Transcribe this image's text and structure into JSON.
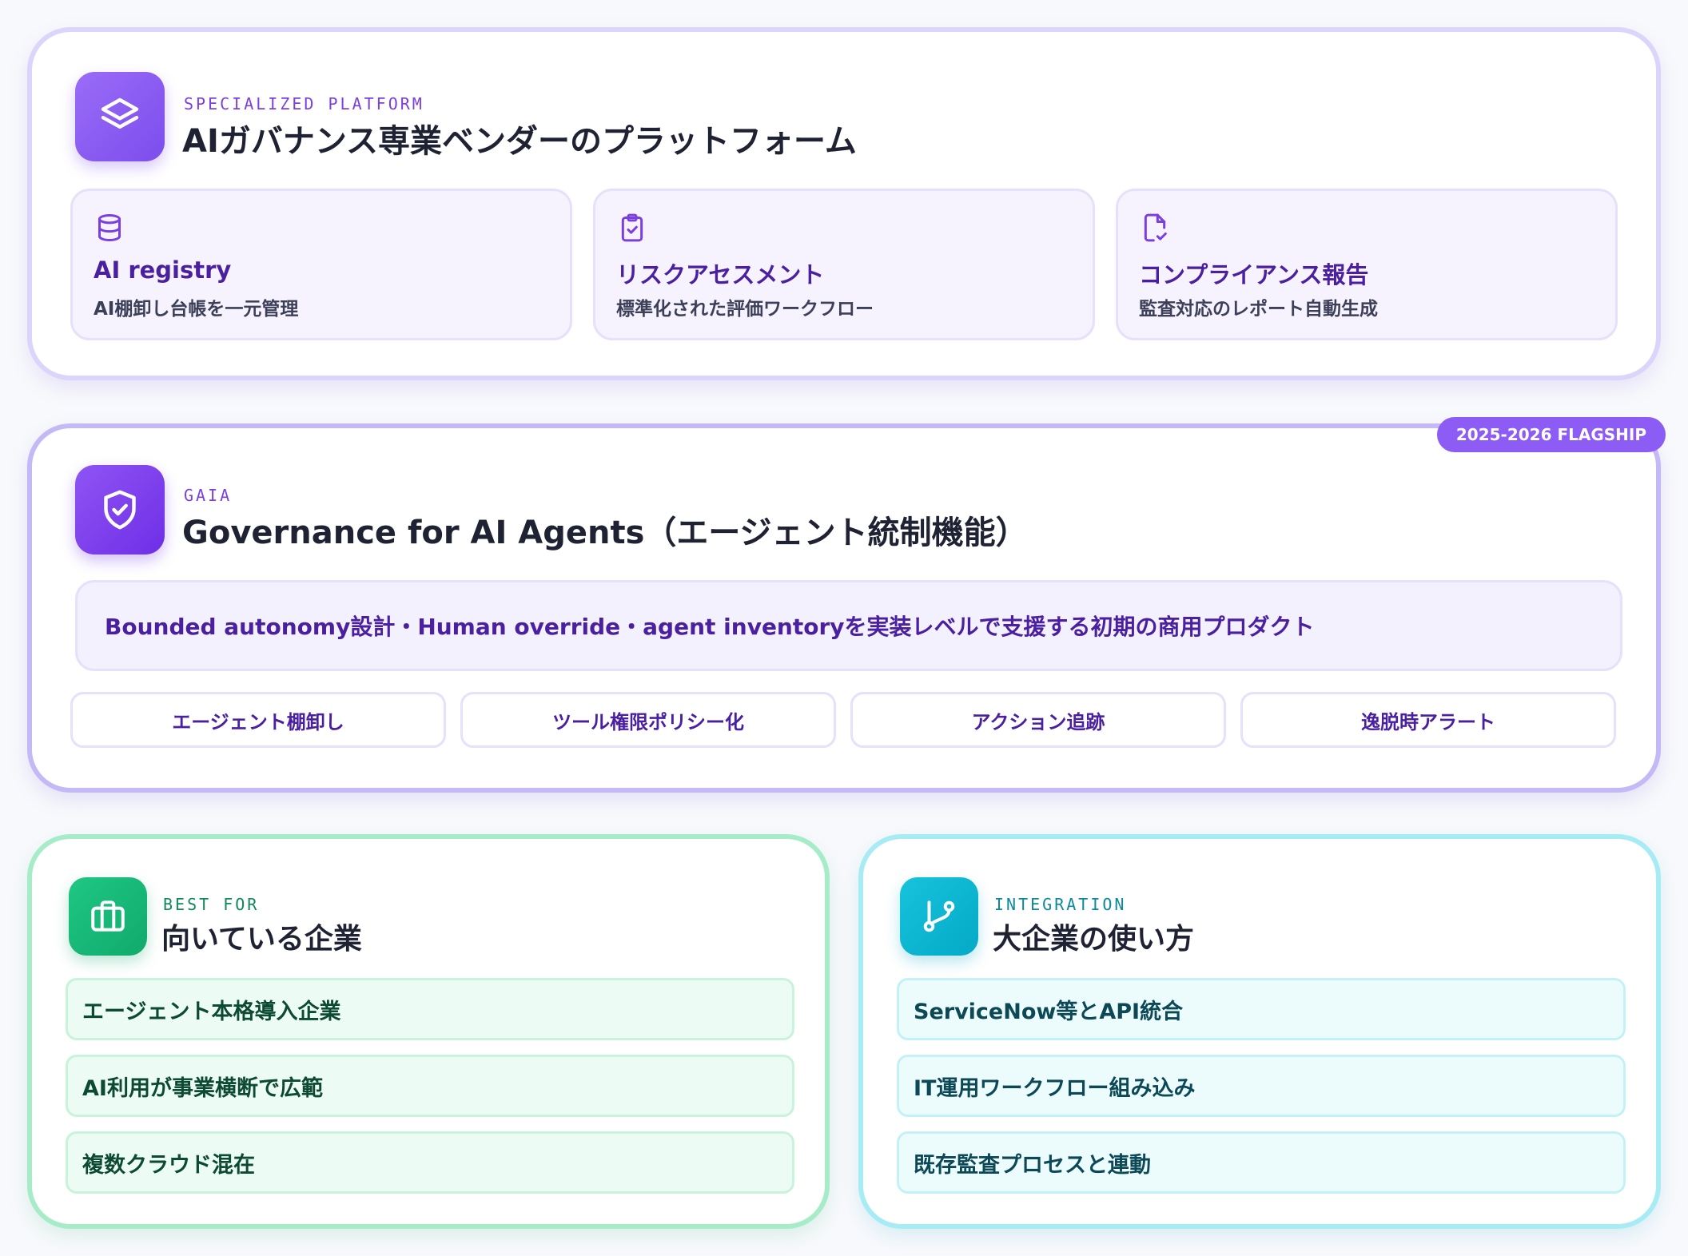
{
  "platform": {
    "eyebrow": "SPECIALIZED PLATFORM",
    "title": "AIガバナンス専業ベンダーのプラットフォーム",
    "icon": "layers-icon",
    "features": [
      {
        "icon": "database-icon",
        "title": "AI registry",
        "desc": "AI棚卸し台帳を一元管理"
      },
      {
        "icon": "clipboard-check-icon",
        "title": "リスクアセスメント",
        "desc": "標準化された評価ワークフロー"
      },
      {
        "icon": "file-check-icon",
        "title": "コンプライアンス報告",
        "desc": "監査対応のレポート自動生成"
      }
    ]
  },
  "gaia": {
    "badge": "2025-2026 FLAGSHIP",
    "eyebrow": "GAIA",
    "title": "Governance for AI Agents（エージェント統制機能）",
    "icon": "shield-check-icon",
    "description": "Bounded autonomy設計・Human override・agent inventoryを実装レベルで支援する初期の商用プロダクト",
    "capabilities": [
      "エージェント棚卸し",
      "ツール権限ポリシー化",
      "アクション追跡",
      "逸脱時アラート"
    ]
  },
  "best_for": {
    "eyebrow": "BEST FOR",
    "title": "向いている企業",
    "icon": "briefcase-icon",
    "items": [
      "エージェント本格導入企業",
      "AI利用が事業横断で広範",
      "複数クラウド混在"
    ]
  },
  "integration": {
    "eyebrow": "INTEGRATION",
    "title": "大企業の使い方",
    "icon": "git-branch-icon",
    "items": [
      "ServiceNow等とAPI統合",
      "IT運用ワークフロー組み込み",
      "既存監査プロセスと連動"
    ]
  },
  "colors": {
    "purple_accent": "#7c4ded",
    "green_accent": "#10a96c",
    "cyan_accent": "#04a9c6"
  }
}
